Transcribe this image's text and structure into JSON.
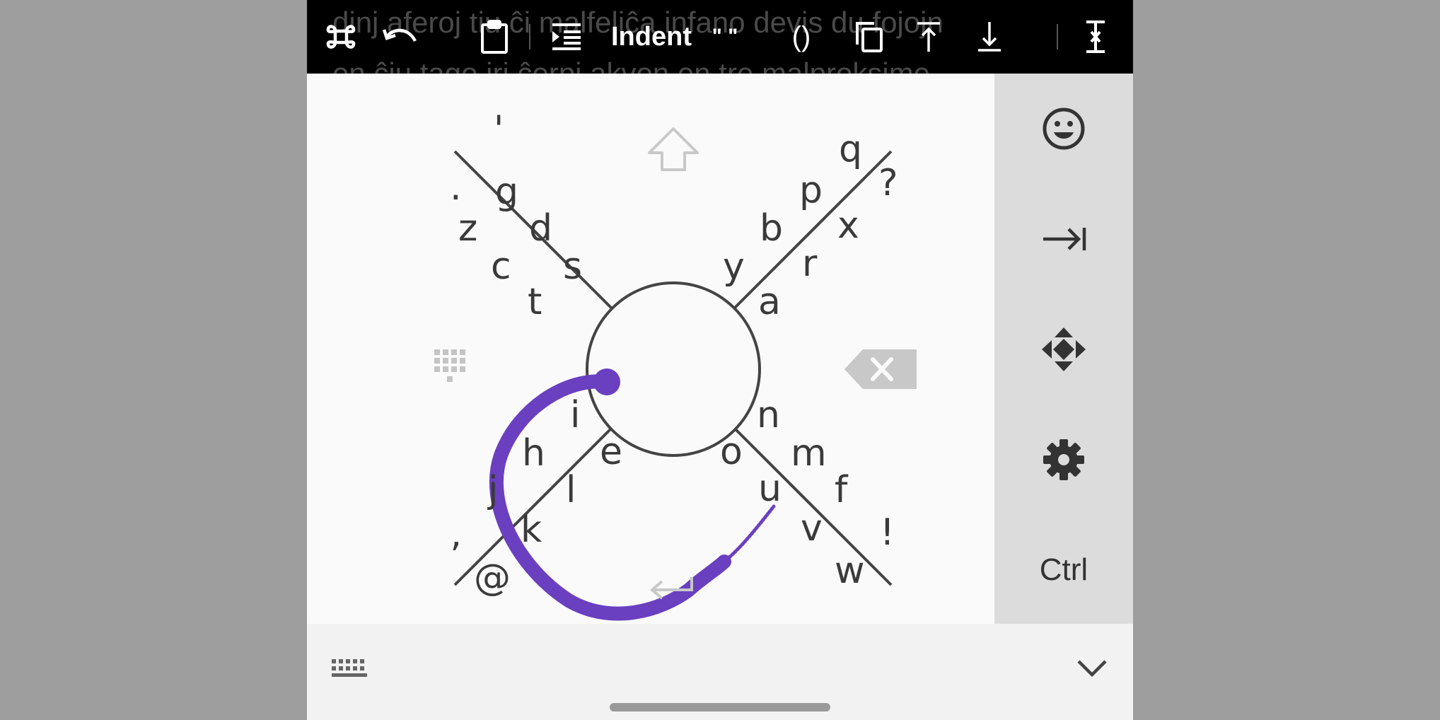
{
  "toolbar": {
    "ghost_text_line1": "dinj aferoj tiu ĉi malfeliĉa infano devis du fojojn",
    "ghost_text_line2": "en ĉiu tago iri ĉerpi akvon en tre malproksime",
    "items": [
      {
        "id": "command",
        "icon": "command-icon"
      },
      {
        "id": "undo",
        "icon": "undo-icon"
      },
      {
        "id": "clipboard",
        "icon": "clipboard-icon"
      },
      {
        "id": "indent",
        "icon": "indent-icon"
      },
      {
        "id": "indent-label",
        "label": "Indent"
      },
      {
        "id": "quotes",
        "label": "\" \""
      },
      {
        "id": "parens",
        "label": "()"
      },
      {
        "id": "copy",
        "icon": "copy-icon"
      },
      {
        "id": "move-top",
        "icon": "arrow-to-top-icon"
      },
      {
        "id": "move-bottom",
        "icon": "arrow-to-bottom-icon"
      },
      {
        "id": "text-cursor",
        "icon": "text-cursor-icon"
      }
    ]
  },
  "keyboard": {
    "top_left": [
      "'",
      ".",
      "g",
      "z",
      "d",
      "c",
      "s",
      "t"
    ],
    "top_right": [
      "q",
      "?",
      "p",
      "x",
      "b",
      "r",
      "y",
      "a"
    ],
    "bottom_left": [
      "i",
      "h",
      "e",
      "j",
      "l",
      "k",
      "’",
      "@"
    ],
    "bottom_right": [
      "n",
      "m",
      "o",
      "f",
      "u",
      "!",
      "v",
      "w"
    ],
    "icons": {
      "shift": "shift-arrow-icon",
      "numpad": "numpad-icon",
      "backspace": "backspace-icon",
      "enter": "enter-icon"
    },
    "gesture_color": "#6a3fc0"
  },
  "side_panel": {
    "items": [
      {
        "id": "emoji",
        "icon": "emoji-icon"
      },
      {
        "id": "tab",
        "icon": "tab-icon"
      },
      {
        "id": "move",
        "icon": "move-arrows-icon"
      },
      {
        "id": "settings",
        "icon": "gear-icon"
      },
      {
        "id": "ctrl",
        "label": "Ctrl"
      }
    ]
  },
  "bottom_bar": {
    "keyboard_switch": "keyboard-icon",
    "collapse": "chevron-down-icon"
  }
}
